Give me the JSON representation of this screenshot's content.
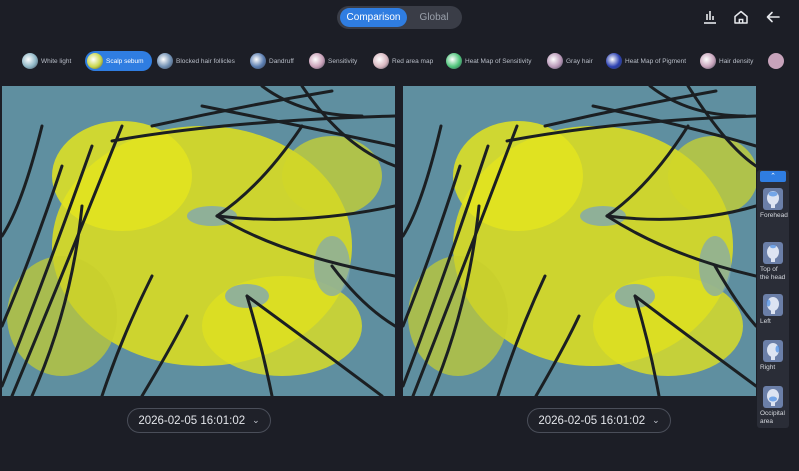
{
  "header": {
    "tabs": [
      {
        "label": "Comparison",
        "active": true
      },
      {
        "label": "Global",
        "active": false
      }
    ],
    "icons": [
      "bar-chart-icon",
      "home-icon",
      "back-arrow-icon"
    ]
  },
  "modes": [
    {
      "label": "White light",
      "color": "#8fb7c6",
      "active": false
    },
    {
      "label": "Scalp sebum",
      "color": "#c9d64a",
      "active": true
    },
    {
      "label": "Blocked hair follicles",
      "color": "#6f8fb3",
      "active": false
    },
    {
      "label": "Dandruff",
      "color": "#5a7db0",
      "active": false
    },
    {
      "label": "Sensitivity",
      "color": "#c9a0b8",
      "active": false
    },
    {
      "label": "Red area map",
      "color": "#d8b7c0",
      "active": false
    },
    {
      "label": "Heat Map of Sensitivity",
      "color": "#4ec47a",
      "active": false
    },
    {
      "label": "Gray hair",
      "color": "#b998b8",
      "active": false
    },
    {
      "label": "Heat Map of Pigment",
      "color": "#2a3fb0",
      "active": false
    },
    {
      "label": "Hair density",
      "color": "#c7a3bb",
      "active": false
    }
  ],
  "comparison": {
    "left_date": "2026-02-05 16:01:02",
    "right_date": "2026-02-05 16:01:02"
  },
  "regions": [
    {
      "label": "Forehead"
    },
    {
      "label": "Top of the head"
    },
    {
      "label": "Left"
    },
    {
      "label": "Right"
    },
    {
      "label": "Occipital area"
    }
  ],
  "colors": {
    "accent": "#2f7de1",
    "background": "#1c1e26",
    "sebum": "#e3e41f"
  }
}
